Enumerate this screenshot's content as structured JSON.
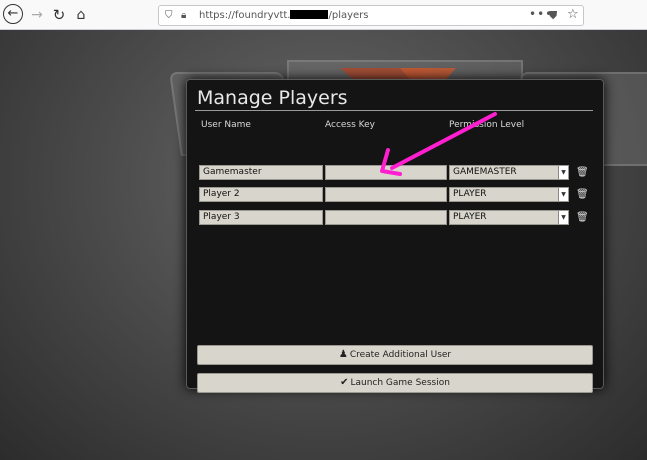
{
  "browser": {
    "url_prefix": "https://foundryvtt.",
    "url_suffix": "/players",
    "more_label": "•••"
  },
  "dialog": {
    "title": "Manage Players",
    "columns": {
      "user_name": "User Name",
      "access_key": "Access Key",
      "permission_level": "Permission Level"
    },
    "players": [
      {
        "name": "Gamemaster",
        "access_key": "",
        "permission": "GAMEMASTER"
      },
      {
        "name": "Player 2",
        "access_key": "",
        "permission": "PLAYER"
      },
      {
        "name": "Player 3",
        "access_key": "",
        "permission": "PLAYER"
      }
    ],
    "create_button": "Create Additional User",
    "launch_button": "Launch Game Session"
  },
  "colors": {
    "annotation_arrow": "#ff1fd0",
    "dialog_bg": "#141414",
    "field_bg": "#d8d6cc"
  },
  "icons": {
    "create_icon": "person-icon",
    "launch_icon": "checkmark-icon",
    "row_delete": "trash-icon"
  }
}
